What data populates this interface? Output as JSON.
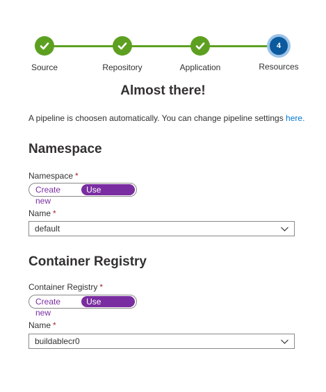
{
  "wizard": {
    "steps": [
      {
        "label": "Source",
        "status": "complete",
        "icon": "checkmark-icon"
      },
      {
        "label": "Repository",
        "status": "complete",
        "icon": "checkmark-icon"
      },
      {
        "label": "Application",
        "status": "complete",
        "icon": "checkmark-icon"
      },
      {
        "label": "Resources",
        "status": "current",
        "number": "4"
      }
    ]
  },
  "title": "Almost there!",
  "info": {
    "text": "A pipeline is choosen automatically. You can change pipeline settings",
    "link_text": "here."
  },
  "namespace_section": {
    "heading": "Namespace",
    "mode_label": "Namespace",
    "required_mark": "*",
    "options": [
      "Create new",
      "Use existing"
    ],
    "selected_option": "Use existing",
    "name_label": "Name",
    "name_value": "default"
  },
  "registry_section": {
    "heading": "Container Registry",
    "mode_label": "Container Registry",
    "required_mark": "*",
    "options": [
      "Create new",
      "Use existing"
    ],
    "selected_option": "Use existing",
    "name_label": "Name",
    "name_value": "buildablecr0"
  },
  "colors": {
    "complete": "#5da021",
    "current": "#0b5a9e",
    "accent": "#7a2da0",
    "link": "#0078d4",
    "required": "#a4262c"
  }
}
